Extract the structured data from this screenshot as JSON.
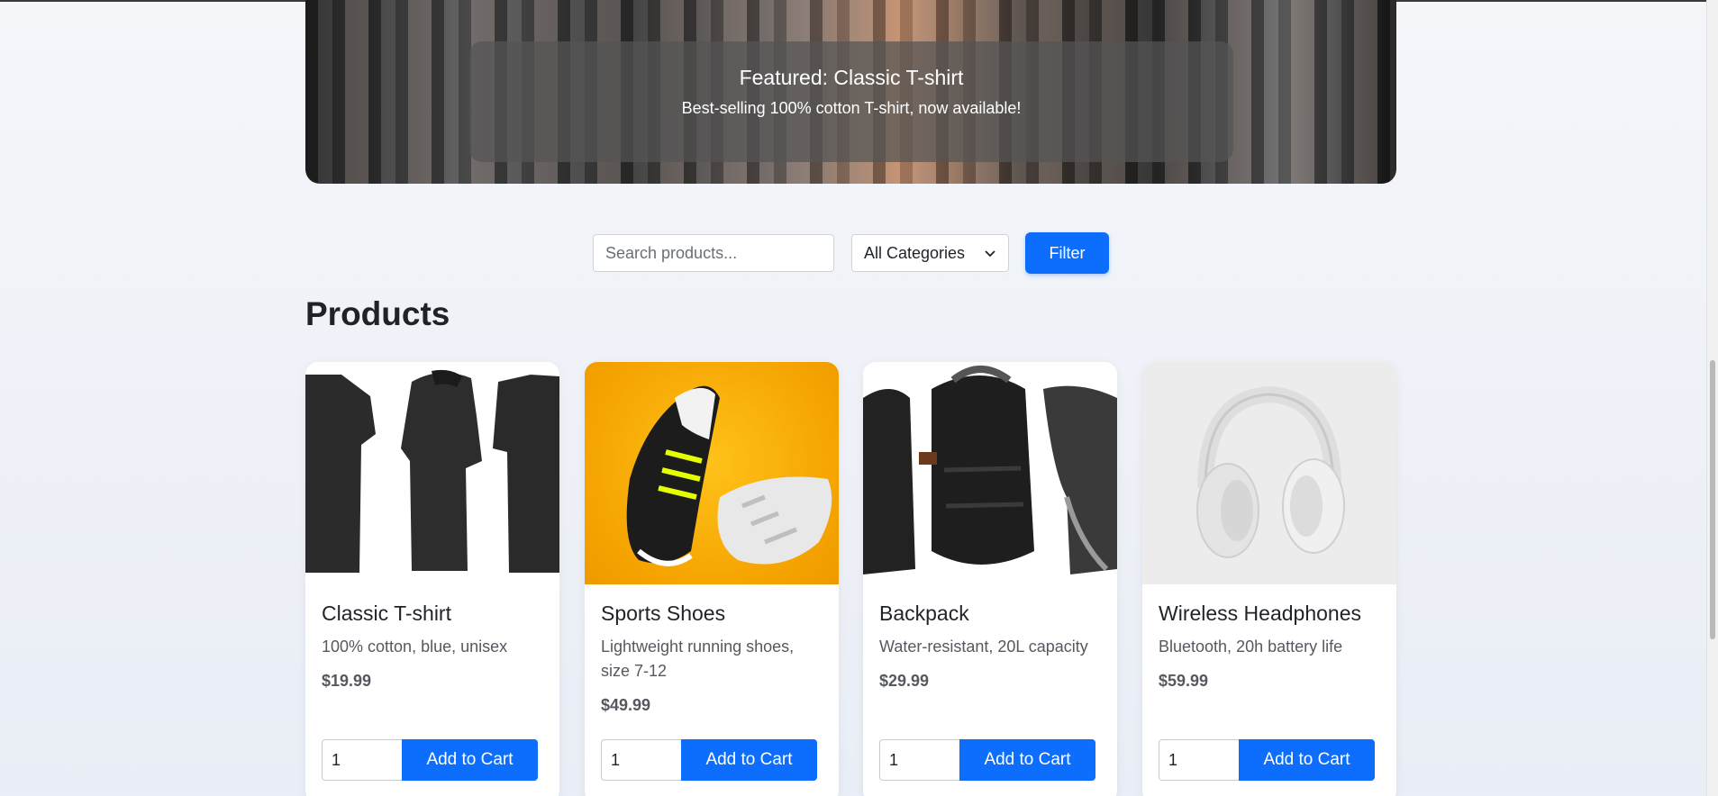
{
  "featured": {
    "title": "Featured: Classic T-shirt",
    "subtitle": "Best-selling 100% cotton T-shirt, now available!"
  },
  "filters": {
    "search_placeholder": "Search products...",
    "category_selected": "All Categories",
    "filter_label": "Filter"
  },
  "products_title": "Products",
  "products": [
    {
      "name": "Classic T-shirt",
      "description": "100% cotton, blue, unisex",
      "price": "$19.99",
      "qty": "1",
      "button": "Add to Cart"
    },
    {
      "name": "Sports Shoes",
      "description": "Lightweight running shoes, size 7-12",
      "price": "$49.99",
      "qty": "1",
      "button": "Add to Cart"
    },
    {
      "name": "Backpack",
      "description": "Water-resistant, 20L capacity",
      "price": "$29.99",
      "qty": "1",
      "button": "Add to Cart"
    },
    {
      "name": "Wireless Headphones",
      "description": "Bluetooth, 20h battery life",
      "price": "$59.99",
      "qty": "1",
      "button": "Add to Cart"
    }
  ],
  "colors": {
    "accent": "#0d6efd",
    "shoe_background": "#f6a800"
  }
}
